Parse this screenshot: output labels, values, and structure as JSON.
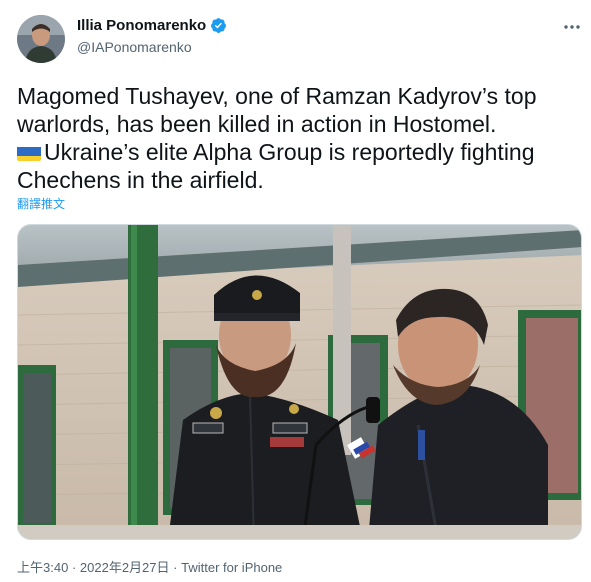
{
  "author": {
    "display_name": "Illia Ponomarenko",
    "handle": "@IAPonomarenko",
    "verified_icon": "verified-badge-icon"
  },
  "tweet": {
    "lines": [
      "Magomed Tushayev, one of Ramzan Kadyrov’s top",
      "warlords, has been killed in action in Hostomel.",
      "Ukraine’s elite Alpha Group is reportedly fighting",
      "Chechens in the airfield."
    ],
    "flag_icon": "ukraine-flag-icon",
    "translate_label": "翻譯推文"
  },
  "meta": {
    "time": "上午3:40",
    "separator": "·",
    "date": "2022年2月27日",
    "source": "Twitter for iPhone"
  },
  "colors": {
    "link": "#1d9bf0",
    "secondary_text": "#536471",
    "verified": "#1d9bf0"
  }
}
